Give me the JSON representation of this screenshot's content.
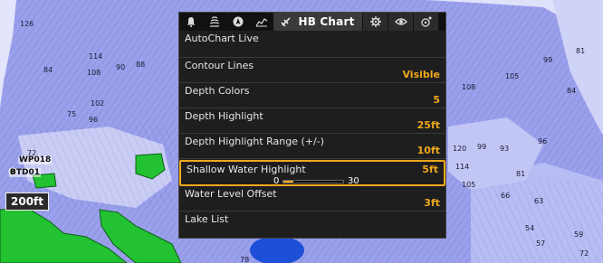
{
  "tabs": {
    "icons": [
      "bell-icon",
      "sonar-waves-icon",
      "navigation-icon",
      "signal-chart-icon"
    ],
    "active_label": "HB Chart",
    "right_icons": [
      "gear-icon",
      "eye-icon",
      "radar-icon"
    ]
  },
  "menu": {
    "items": [
      {
        "name": "AutoChart Live",
        "value": ""
      },
      {
        "name": "Contour Lines",
        "value": "Visible"
      },
      {
        "name": "Depth Colors",
        "value": "5"
      },
      {
        "name": "Depth Highlight",
        "value": "25ft"
      },
      {
        "name": "Depth Highlight Range (+/-)",
        "value": "10ft"
      },
      {
        "name": "Shallow Water Highlight",
        "value": "5ft",
        "slider": {
          "min": "0",
          "max": "30",
          "level": 0.17
        }
      },
      {
        "name": "Water Level Offset",
        "value": "3ft"
      },
      {
        "name": "Lake List",
        "value": ""
      }
    ]
  },
  "chart": {
    "depth_readout": "200ft",
    "waypoints": [
      "WP018",
      "BTD01"
    ],
    "depth_labels": [
      "126",
      "84",
      "114",
      "108",
      "90",
      "88",
      "96",
      "102",
      "72",
      "75",
      "81",
      "99",
      "105",
      "108",
      "84",
      "120",
      "99",
      "93",
      "96",
      "81",
      "114",
      "105",
      "66",
      "63",
      "54",
      "57",
      "78",
      "72",
      "59"
    ],
    "colors": {
      "deep": "#8c93e6",
      "mid": "#aeb4f2",
      "shallow": "#d8dcfa",
      "land": "#e9ecfb",
      "highlight": "#22c232",
      "water_blue": "#1e4fd8",
      "accent": "#f0a81c"
    }
  }
}
